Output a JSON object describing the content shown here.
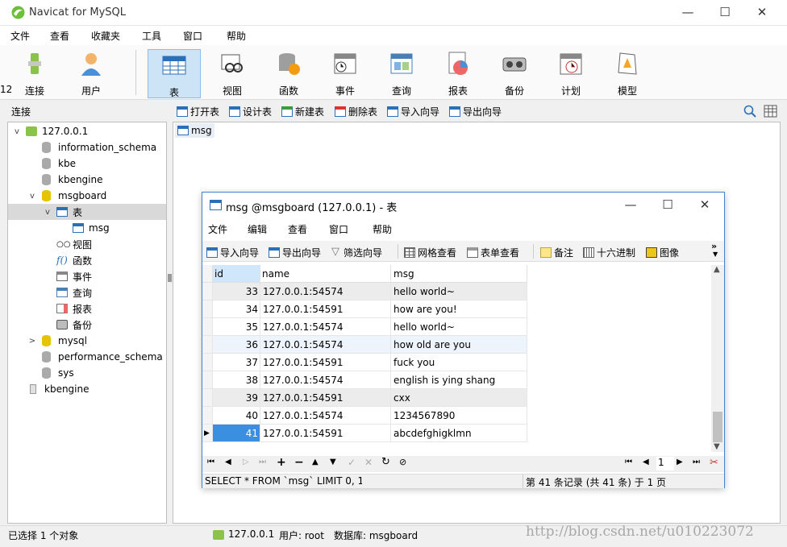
{
  "app": {
    "title": "Navicat for MySQL",
    "window_controls": [
      "—",
      "☐",
      "✕"
    ],
    "menu": [
      "文件",
      "查看",
      "收藏夹",
      "工具",
      "窗口",
      "帮助"
    ],
    "toolbar": [
      {
        "label": "连接",
        "icon": "connection-icon"
      },
      {
        "label": "用户",
        "icon": "user-icon"
      },
      {
        "label": "表",
        "icon": "table-icon",
        "active": true
      },
      {
        "label": "视图",
        "icon": "view-icon"
      },
      {
        "label": "函数",
        "icon": "function-icon"
      },
      {
        "label": "事件",
        "icon": "event-icon"
      },
      {
        "label": "查询",
        "icon": "query-icon"
      },
      {
        "label": "报表",
        "icon": "report-icon"
      },
      {
        "label": "备份",
        "icon": "backup-icon"
      },
      {
        "label": "计划",
        "icon": "schedule-icon"
      },
      {
        "label": "模型",
        "icon": "model-icon"
      }
    ],
    "subbar_left": "连接",
    "subbar": [
      "打开表",
      "设计表",
      "新建表",
      "删除表",
      "导入向导",
      "导出向导"
    ],
    "content_tab": "msg"
  },
  "tree": [
    {
      "label": "127.0.0.1",
      "arrow": "v"
    },
    {
      "label": "information_schema"
    },
    {
      "label": "kbe"
    },
    {
      "label": "kbengine"
    },
    {
      "label": "msgboard",
      "arrow": "v"
    },
    {
      "label": "表",
      "arrow": "v"
    },
    {
      "label": "msg"
    },
    {
      "label": "视图"
    },
    {
      "label": "函数"
    },
    {
      "label": "事件"
    },
    {
      "label": "查询"
    },
    {
      "label": "报表"
    },
    {
      "label": "备份"
    },
    {
      "label": "mysql",
      "arrow": ">"
    },
    {
      "label": "performance_schema"
    },
    {
      "label": "sys"
    },
    {
      "label": "kbengine"
    }
  ],
  "status": {
    "left": "已选择 1 个对象",
    "conn": "127.0.0.1",
    "user": "用户: root",
    "db": "数据库: msgboard",
    "watermark": "http://blog.csdn.net/u010223072"
  },
  "child": {
    "title": "msg @msgboard (127.0.0.1) - 表",
    "menu": [
      "文件",
      "编辑",
      "查看",
      "窗口",
      "帮助"
    ],
    "tools": [
      "导入向导",
      "导出向导",
      "筛选向导",
      "网格查看",
      "表单查看",
      "备注",
      "十六进制",
      "图像"
    ],
    "columns": [
      "id",
      "name",
      "msg"
    ],
    "rows": [
      [
        "33",
        "127.0.0.1:54574",
        "hello world~"
      ],
      [
        "34",
        "127.0.0.1:54591",
        "how are you!"
      ],
      [
        "35",
        "127.0.0.1:54574",
        "hello world~"
      ],
      [
        "36",
        "127.0.0.1:54574",
        "how old are you"
      ],
      [
        "37",
        "127.0.0.1:54591",
        "fuck you"
      ],
      [
        "38",
        "127.0.0.1:54574",
        "english is ying shang"
      ],
      [
        "39",
        "127.0.0.1:54591",
        "cxx"
      ],
      [
        "40",
        "127.0.0.1:54574",
        "1234567890"
      ],
      [
        "41",
        "127.0.0.1:54591",
        "abcdefghigklmn"
      ]
    ],
    "page_number": "1",
    "sql": "SELECT * FROM `msg` LIMIT 0, 1C",
    "record_info": "第 41 条记录 (共 41 条) 于 1 页",
    "left_edge_text": "12"
  },
  "colors": {
    "accent": "#3e85d1",
    "selected_row": "#3b8fe0",
    "toolbar_active": "#cde4f7"
  }
}
